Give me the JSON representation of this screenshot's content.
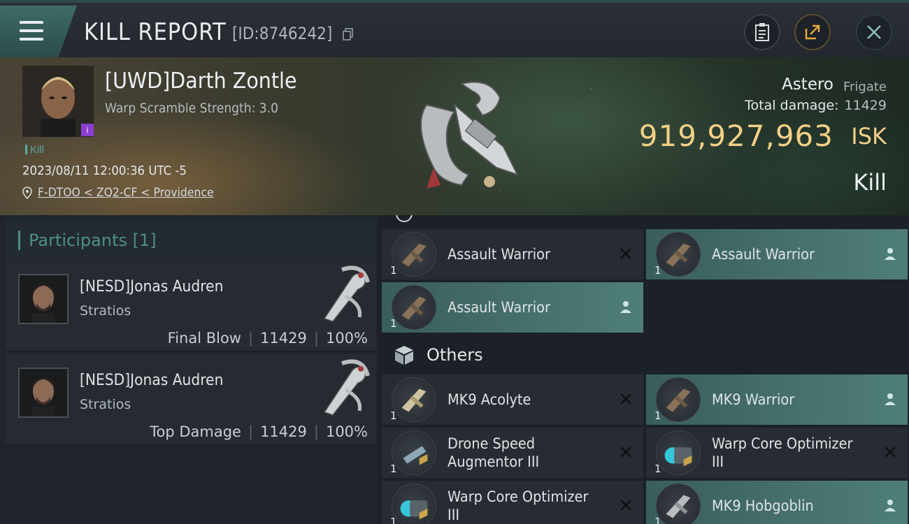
{
  "header": {
    "title": "KILL REPORT",
    "report_id": "[ID:8746242]",
    "icons": [
      "menu-icon",
      "copy-icon",
      "clipboard-icon",
      "share-icon",
      "close-icon"
    ]
  },
  "victim": {
    "name": "[UWD]Darth Zontle",
    "warp_scramble": "Warp Scramble Strength: 3.0",
    "tag": "Kill",
    "datetime": "2023/08/11 12:00:36 UTC -5",
    "location": "F-DTOO < ZQ2-CF < Providence",
    "ship_name": "Astero",
    "ship_class": "Frigate",
    "total_damage_label": "Total damage:",
    "total_damage": "11429",
    "isk_value": "919,927,963",
    "isk_unit": "ISK",
    "result": "Kill"
  },
  "participants": {
    "label": "Participants [1]",
    "cards": [
      {
        "name": "[NESD]Jonas Audren",
        "ship": "Stratios",
        "role": "Final Blow",
        "damage": "11429",
        "percent": "100%"
      },
      {
        "name": "[NESD]Jonas Audren",
        "ship": "Stratios",
        "role": "Top Damage",
        "damage": "11429",
        "percent": "100%"
      }
    ]
  },
  "items": {
    "drones": [
      {
        "name": "Assault Warrior",
        "qty": "1",
        "status": "destroyed"
      },
      {
        "name": "Assault Warrior",
        "qty": "1",
        "status": "dropped"
      },
      {
        "name": "Assault Warrior",
        "qty": "1",
        "status": "dropped"
      }
    ],
    "others_label": "Others",
    "others": [
      {
        "name": "MK9  Acolyte",
        "qty": "1",
        "status": "destroyed"
      },
      {
        "name": "MK9  Warrior",
        "qty": "1",
        "status": "dropped"
      },
      {
        "name": "Drone Speed Augmentor III",
        "qty": "1",
        "status": "destroyed"
      },
      {
        "name": "Warp Core Optimizer III",
        "qty": "1",
        "status": "destroyed"
      },
      {
        "name": "Warp Core Optimizer III",
        "qty": "1",
        "status": "destroyed"
      },
      {
        "name": "MK9  Hobgoblin",
        "qty": "1",
        "status": "dropped"
      }
    ]
  },
  "colors": {
    "accent_teal": "#4f7e78",
    "isk_gold": "#f2cf86",
    "dropped_bg": "#3a5e5a"
  }
}
